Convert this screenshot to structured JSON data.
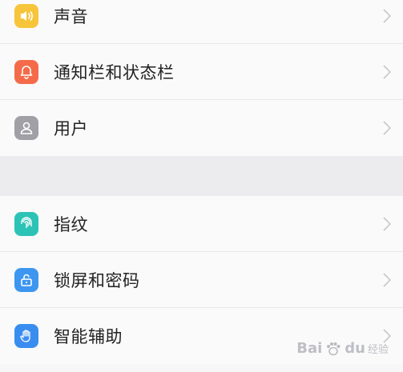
{
  "settings": {
    "group1": [
      {
        "label": "声音",
        "icon": "speaker-icon",
        "color": "#f7c53b"
      },
      {
        "label": "通知栏和状态栏",
        "icon": "bell-icon",
        "color": "#f46b4a"
      },
      {
        "label": "用户",
        "icon": "user-icon",
        "color": "#a0a0a6"
      }
    ],
    "group2": [
      {
        "label": "指纹",
        "icon": "fingerprint-icon",
        "color": "#2cc3b6"
      },
      {
        "label": "锁屏和密码",
        "icon": "lock-icon",
        "color": "#3d96f0"
      },
      {
        "label": "智能辅助",
        "icon": "hand-icon",
        "color": "#3a8df0"
      }
    ]
  },
  "watermark": {
    "brand_left": "Bai",
    "brand_right": "du",
    "sub": "经验"
  }
}
